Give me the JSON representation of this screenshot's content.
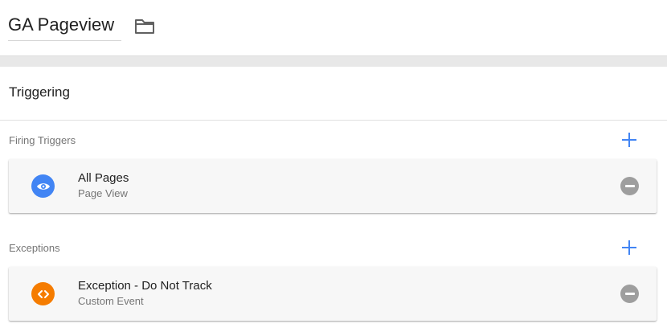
{
  "header": {
    "title": "GA Pageview",
    "folder_icon": "folder-icon"
  },
  "triggering": {
    "title": "Triggering",
    "firing": {
      "label": "Firing Triggers",
      "add_icon": "plus-icon",
      "items": [
        {
          "name": "All Pages",
          "type": "Page View",
          "icon": "eye-icon",
          "icon_color": "#4285f4",
          "remove_icon": "minus-circle-icon"
        }
      ]
    },
    "exceptions": {
      "label": "Exceptions",
      "add_icon": "plus-icon",
      "items": [
        {
          "name": "Exception - Do Not Track",
          "type": "Custom Event",
          "icon": "code-brackets-icon",
          "icon_color": "#f57c00",
          "remove_icon": "minus-circle-icon"
        }
      ]
    }
  },
  "colors": {
    "accent": "#4285f4",
    "remove": "#9e9e9e",
    "muted_text": "#757575"
  }
}
